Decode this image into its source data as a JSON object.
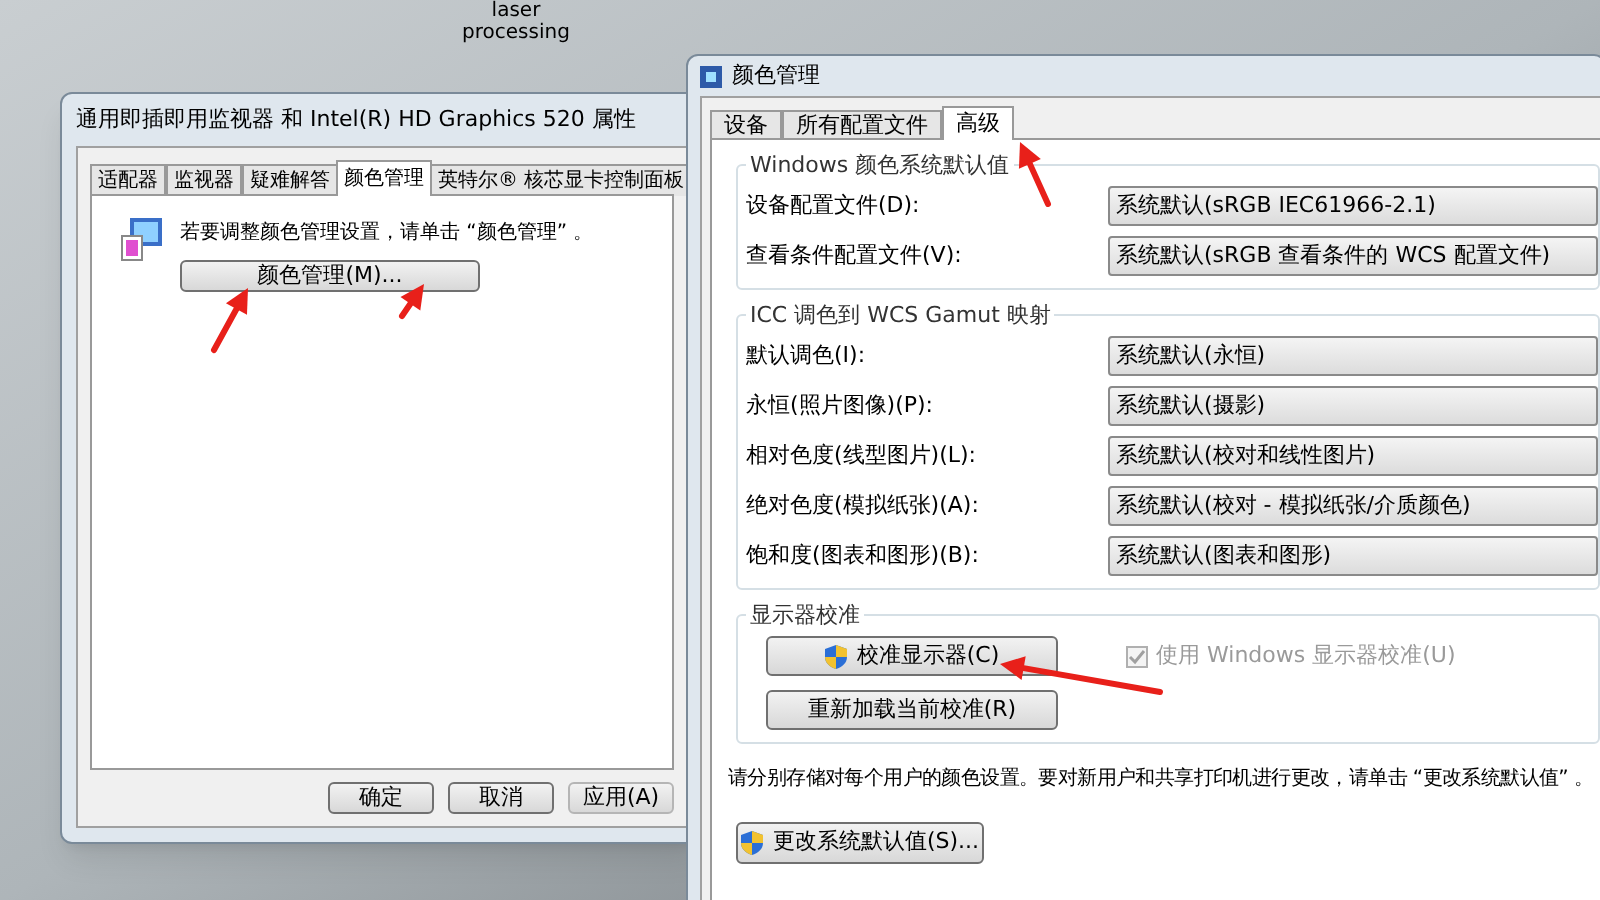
{
  "desktop": {
    "icons": [
      {
        "label": "laser processing"
      }
    ]
  },
  "properties_dialog": {
    "title": "通用即插即用监视器 和 Intel(R) HD Graphics 520 属性",
    "tabs": [
      {
        "label": "适配器",
        "selected": false
      },
      {
        "label": "监视器",
        "selected": false
      },
      {
        "label": "疑难解答",
        "selected": false
      },
      {
        "label": "颜色管理",
        "selected": true
      },
      {
        "label": "英特尔® 核芯显卡控制面板",
        "selected": false
      }
    ],
    "message": "若要调整颜色管理设置，请单击 “颜色管理” 。",
    "color_button": "颜色管理(M)...",
    "buttons": [
      {
        "label": "确定",
        "disabled": false
      },
      {
        "label": "取消",
        "disabled": false
      },
      {
        "label": "应用(A)",
        "disabled": true
      }
    ]
  },
  "color_dialog": {
    "title": "颜色管理",
    "tabs": [
      {
        "label": "设备",
        "selected": false
      },
      {
        "label": "所有配置文件",
        "selected": false
      },
      {
        "label": "高级",
        "selected": true
      }
    ],
    "groups": [
      {
        "title": "Windows 颜色系统默认值",
        "rows": [
          {
            "label": "设备配置文件(D):",
            "value": "系统默认(sRGB IEC61966-2.1)"
          },
          {
            "label": "查看条件配置文件(V):",
            "value": "系统默认(sRGB 查看条件的 WCS 配置文件)"
          }
        ]
      },
      {
        "title": "ICC 调色到 WCS Gamut 映射",
        "rows": [
          {
            "label": "默认调色(I):",
            "value": "系统默认(永恒)"
          },
          {
            "label": "永恒(照片图像)(P):",
            "value": "系统默认(摄影)"
          },
          {
            "label": "相对色度(线型图片)(L):",
            "value": "系统默认(校对和线性图片)"
          },
          {
            "label": "绝对色度(模拟纸张)(A):",
            "value": "系统默认(校对 - 模拟纸张/介质颜色)"
          },
          {
            "label": "饱和度(图表和图形)(B):",
            "value": "系统默认(图表和图形)"
          }
        ]
      }
    ],
    "calibration": {
      "title": "显示器校准",
      "calibrate_button": "校准显示器(C)",
      "reload_button": "重新加载当前校准(R)",
      "checkbox": {
        "label": "使用 Windows 显示器校准(U)",
        "checked": true,
        "disabled": true
      }
    },
    "note": "请分别存储对每个用户的颜色设置。要对新用户和共享打印机进行更改，请单击 “更改系统默认值” 。",
    "defaults_button": "更改系统默认值(S)..."
  }
}
